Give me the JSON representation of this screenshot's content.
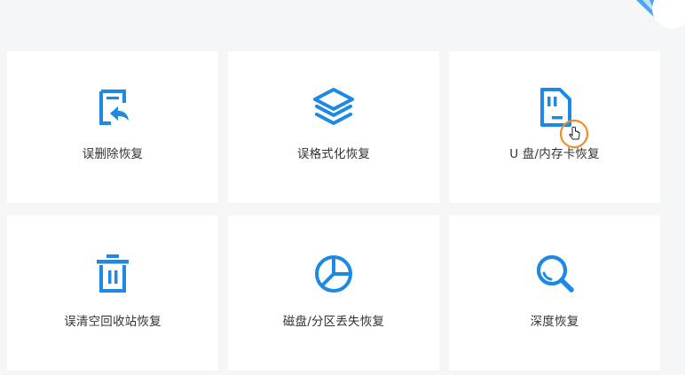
{
  "theme": {
    "accent": "#1e88e5",
    "background": "#f5f6f8",
    "card": "#ffffff",
    "text": "#333333",
    "cursor_ring": "#f28c28"
  },
  "cards": [
    {
      "label": "误删除恢复",
      "icon": "file-restore-icon"
    },
    {
      "label": "误格式化恢复",
      "icon": "layers-icon"
    },
    {
      "label": "U 盘/内存卡恢复",
      "icon": "sd-card-icon"
    },
    {
      "label": "误清空回收站恢复",
      "icon": "trash-icon"
    },
    {
      "label": "磁盘/分区丢失恢复",
      "icon": "pie-chart-icon"
    },
    {
      "label": "深度恢复",
      "icon": "magnifier-icon"
    }
  ]
}
